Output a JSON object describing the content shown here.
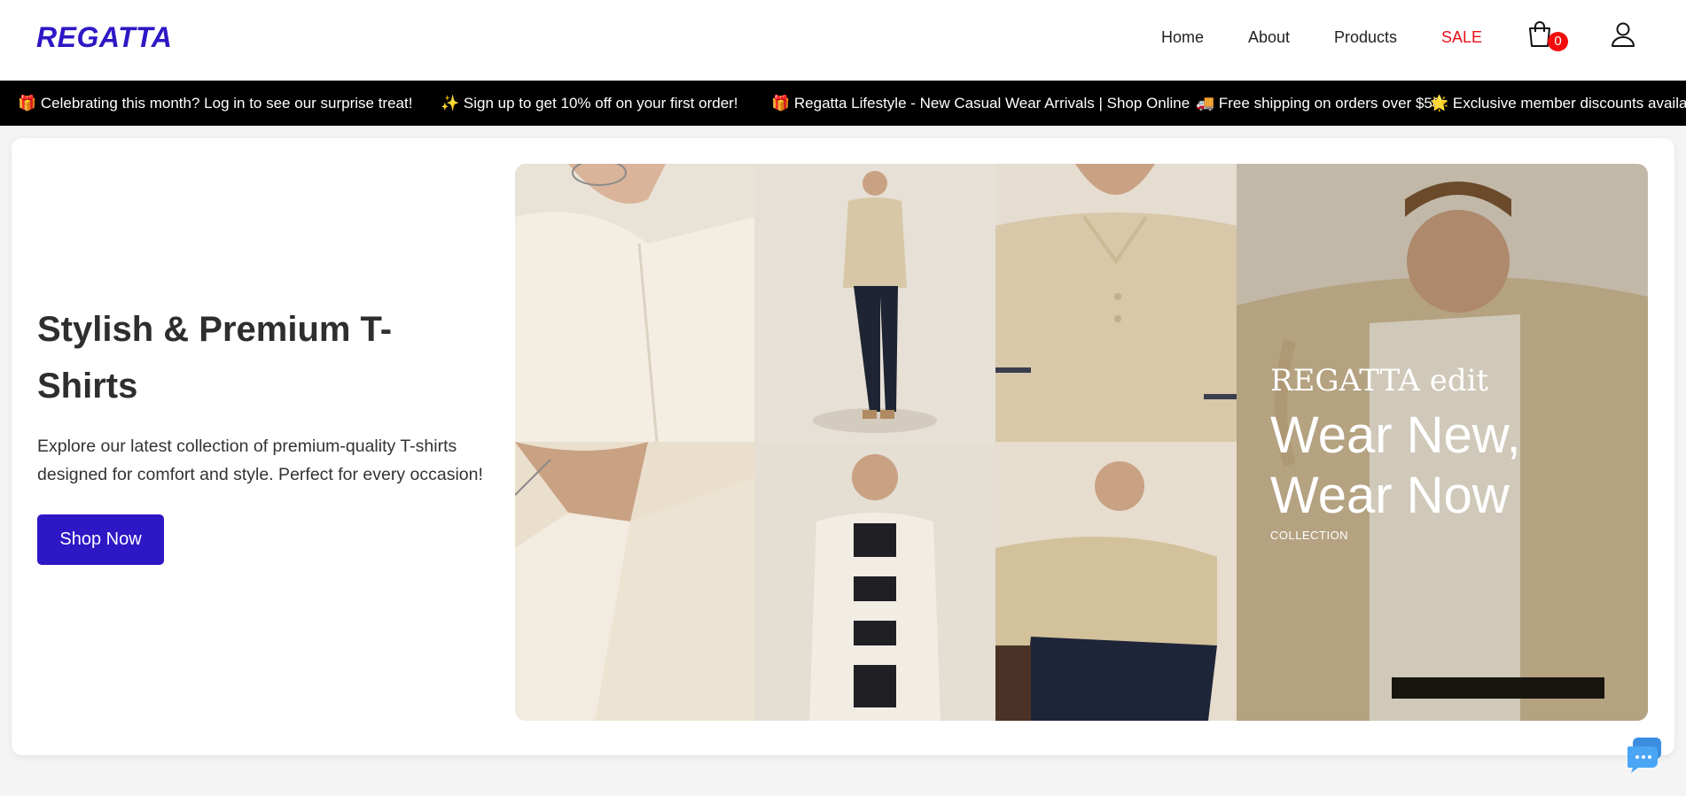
{
  "header": {
    "logo": "REGATTA",
    "nav": [
      "Home",
      "About",
      "Products",
      "SALE"
    ],
    "cart_count": "0"
  },
  "ticker": {
    "items": [
      "🎁 Celebrating this month? Log in to see our surprise treat!",
      "✨ Sign up to get 10% off on your first order!",
      "🎁 Regatta Lifestyle - New Casual Wear Arrivals | Shop Online",
      "🚚 Free shipping on orders over $50",
      "🌟 Exclusive member discounts availab"
    ]
  },
  "hero": {
    "title": "Stylish & Premium T-Shirts",
    "description": "Explore our latest collection of premium-quality T-shirts designed for comfort and style. Perfect for every occasion!",
    "cta": "Shop Now"
  },
  "banner": {
    "brand": "REGATTA edit",
    "headline_line1": "Wear New,",
    "headline_line2": "Wear Now",
    "tag": "COLLECTION"
  },
  "colors": {
    "brand": "#2e17c5",
    "sale": "#e8101a",
    "ticker_bg": "#000000",
    "badge": "#f20d0d"
  },
  "icons": [
    "cart-icon",
    "user-icon",
    "chat-icon"
  ]
}
